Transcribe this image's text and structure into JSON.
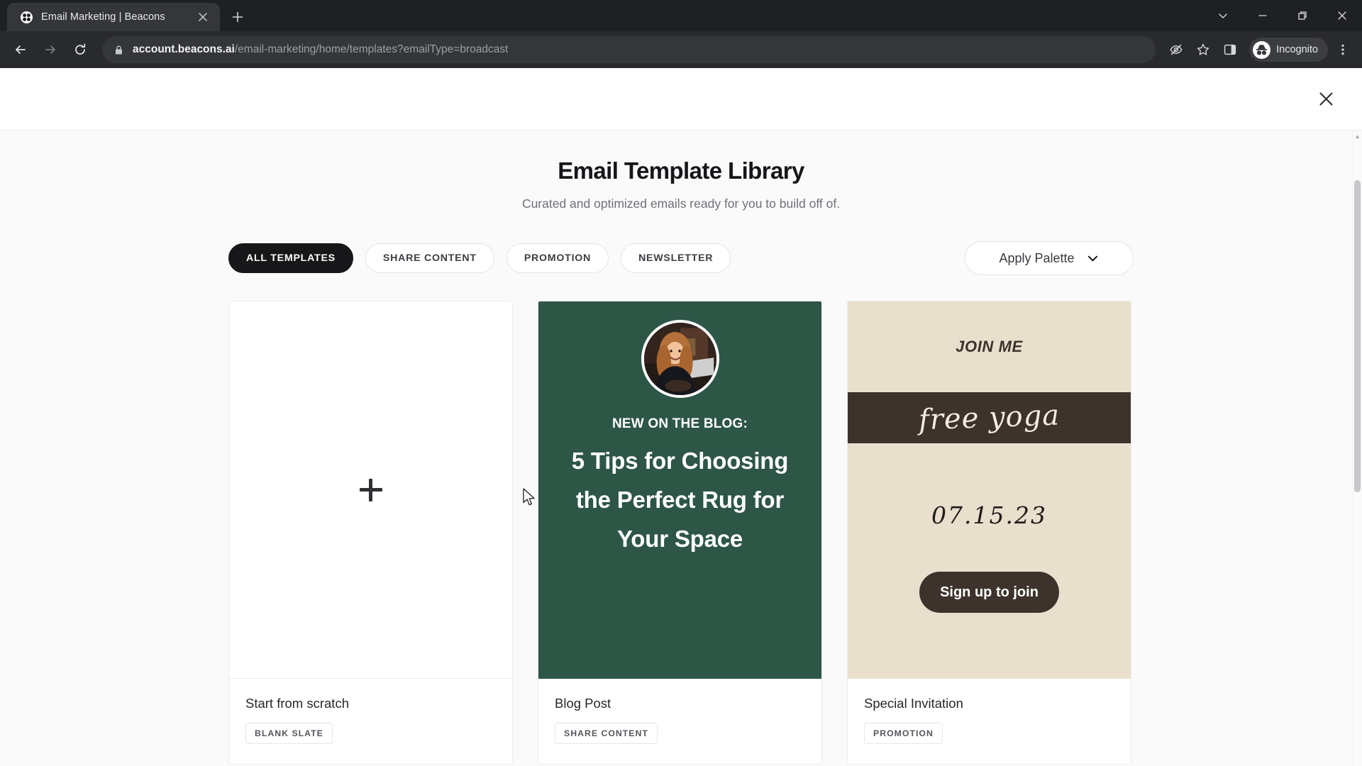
{
  "browser": {
    "tab": {
      "title": "Email Marketing | Beacons",
      "favicon": "beacons-favicon",
      "close": "×"
    },
    "new_tab_label": "+",
    "window_controls": {
      "minimize": "—",
      "maximize": "❐",
      "close": "✕",
      "tab_search": "⌄"
    },
    "nav": {
      "back": "←",
      "forward": "→",
      "reload": "⟳"
    },
    "omnibox": {
      "lock_icon": "lock-icon",
      "host": "account.beacons.ai",
      "path": "/email-marketing/home/templates?emailType=broadcast",
      "full_url": "account.beacons.ai/email-marketing/home/templates?emailType=broadcast"
    },
    "toolbar_icons": [
      {
        "name": "tracking-protection-icon",
        "glyph": "eye-slash"
      },
      {
        "name": "bookmark-star-icon",
        "glyph": "star"
      },
      {
        "name": "side-panel-icon",
        "glyph": "panel"
      }
    ],
    "profile": {
      "label": "Incognito",
      "icon": "incognito-icon"
    },
    "menu_icon": "three-dot-menu-icon"
  },
  "modal": {
    "close_label": "✕"
  },
  "hero": {
    "title": "Email Template Library",
    "subtitle": "Curated and optimized emails ready for you to build off of."
  },
  "filters": [
    {
      "label": "ALL TEMPLATES",
      "active": true
    },
    {
      "label": "SHARE CONTENT",
      "active": false
    },
    {
      "label": "PROMOTION",
      "active": false
    },
    {
      "label": "NEWSLETTER",
      "active": false
    }
  ],
  "palette": {
    "label": "Apply Palette",
    "chevron": "chevron-down-icon"
  },
  "cards": [
    {
      "kind": "blank",
      "title": "Start from scratch",
      "tag": "BLANK SLATE",
      "plus_icon": "plus-icon"
    },
    {
      "kind": "blog",
      "title": "Blog Post",
      "tag": "SHARE CONTENT",
      "preview": {
        "eyebrow": "NEW ON THE BLOG:",
        "headline": "5 Tips for Choosing the Perfect Rug for Your Space",
        "background_color": "#2d5647",
        "avatar": "author-portrait"
      }
    },
    {
      "kind": "invitation",
      "title": "Special Invitation",
      "tag": "PROMOTION",
      "preview": {
        "join": "JOIN ME",
        "script": "free yoga",
        "date": "07.15.23",
        "button": "Sign up to join",
        "background_color": "#e9dfcd",
        "band_color": "#3d322c"
      }
    }
  ],
  "colors": {
    "accent_dark": "#17171a",
    "page_bg": "#fafafb",
    "blog_green": "#2d5647",
    "invite_beige": "#e9dfcd",
    "invite_brown": "#3d322c"
  }
}
